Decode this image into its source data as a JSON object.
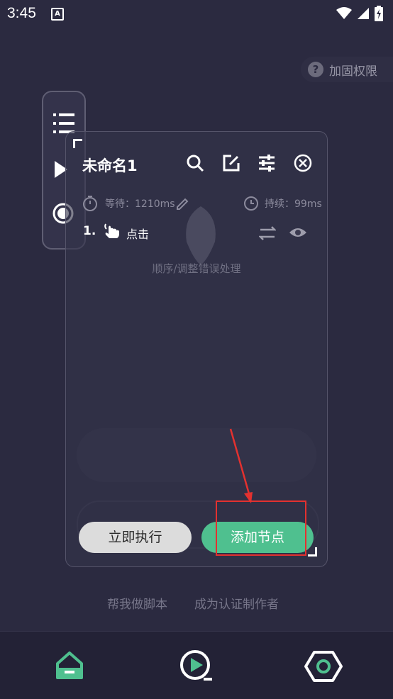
{
  "status_bar": {
    "time": "3:45",
    "notification_icon": "A"
  },
  "header": {
    "permission_button": "加固权限"
  },
  "dialog": {
    "title": "未命名1",
    "wait_label": "等待：1210ms",
    "duration_label": "持续：99ms",
    "step": {
      "number": "1.",
      "label": "点击"
    },
    "ghost_hint": "顺序/调整错误处理",
    "run_button": "立即执行",
    "add_node_button": "添加节点"
  },
  "footer": {
    "help_link": "帮我做脚本",
    "author_link": "成为认证制作者"
  },
  "colors": {
    "background": "#2b2a40",
    "accent": "#4fc08f",
    "annotation_red": "#e3312f"
  },
  "icons": [
    "search-icon",
    "edit-icon",
    "sliders-icon",
    "close-circle-icon",
    "timer-icon",
    "pencil-icon",
    "clock-icon",
    "tap-gesture-icon",
    "swap-icon",
    "eye-icon",
    "home-icon",
    "play-icon",
    "settings-hex-icon"
  ]
}
